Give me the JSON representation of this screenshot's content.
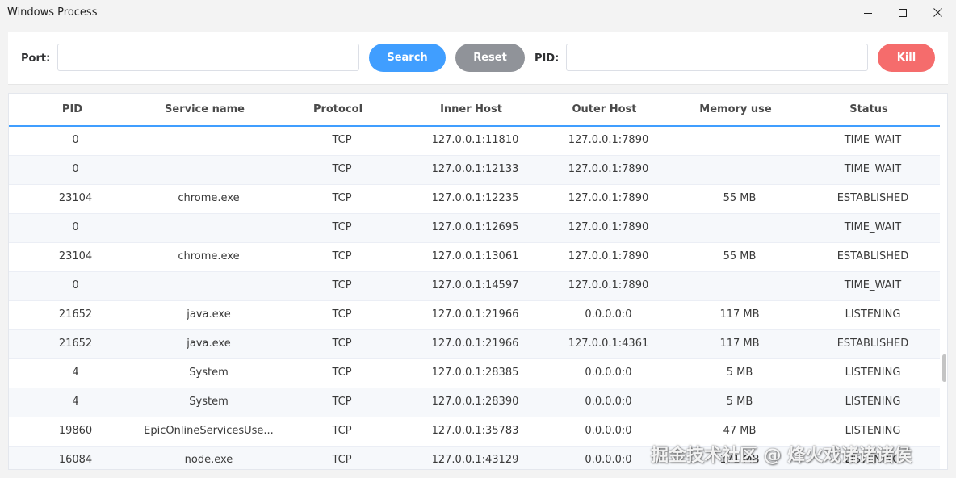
{
  "window": {
    "title": "Windows Process",
    "minimize_icon": "minimize-icon",
    "maximize_icon": "maximize-icon",
    "close_icon": "close-icon"
  },
  "toolbar": {
    "port_label": "Port:",
    "port_value": "",
    "search_label": "Search",
    "reset_label": "Reset",
    "pid_label": "PID:",
    "pid_value": "",
    "kill_label": "Kill",
    "colors": {
      "search": "#409eff",
      "reset": "#909399",
      "kill": "#f56c6c"
    }
  },
  "table": {
    "columns": [
      "PID",
      "Service name",
      "Protocol",
      "Inner Host",
      "Outer Host",
      "Memory use",
      "Status"
    ],
    "rows": [
      [
        "0",
        "",
        "TCP",
        "127.0.0.1:11810",
        "127.0.0.1:7890",
        "",
        "TIME_WAIT"
      ],
      [
        "0",
        "",
        "TCP",
        "127.0.0.1:12133",
        "127.0.0.1:7890",
        "",
        "TIME_WAIT"
      ],
      [
        "23104",
        "chrome.exe",
        "TCP",
        "127.0.0.1:12235",
        "127.0.0.1:7890",
        "55 MB",
        "ESTABLISHED"
      ],
      [
        "0",
        "",
        "TCP",
        "127.0.0.1:12695",
        "127.0.0.1:7890",
        "",
        "TIME_WAIT"
      ],
      [
        "23104",
        "chrome.exe",
        "TCP",
        "127.0.0.1:13061",
        "127.0.0.1:7890",
        "55 MB",
        "ESTABLISHED"
      ],
      [
        "0",
        "",
        "TCP",
        "127.0.0.1:14597",
        "127.0.0.1:7890",
        "",
        "TIME_WAIT"
      ],
      [
        "21652",
        "java.exe",
        "TCP",
        "127.0.0.1:21966",
        "0.0.0.0:0",
        "117 MB",
        "LISTENING"
      ],
      [
        "21652",
        "java.exe",
        "TCP",
        "127.0.0.1:21966",
        "127.0.0.1:4361",
        "117 MB",
        "ESTABLISHED"
      ],
      [
        "4",
        "System",
        "TCP",
        "127.0.0.1:28385",
        "0.0.0.0:0",
        "5 MB",
        "LISTENING"
      ],
      [
        "4",
        "System",
        "TCP",
        "127.0.0.1:28390",
        "0.0.0.0:0",
        "5 MB",
        "LISTENING"
      ],
      [
        "19860",
        "EpicOnlineServicesUse...",
        "TCP",
        "127.0.0.1:35783",
        "0.0.0.0:0",
        "47 MB",
        "LISTENING"
      ],
      [
        "16084",
        "node.exe",
        "TCP",
        "127.0.0.1:43129",
        "0.0.0.0:0",
        "171 MB",
        "LISTENING"
      ]
    ]
  },
  "watermark": "掘金技术社区 @ 烽火戏诸诸诸侯"
}
